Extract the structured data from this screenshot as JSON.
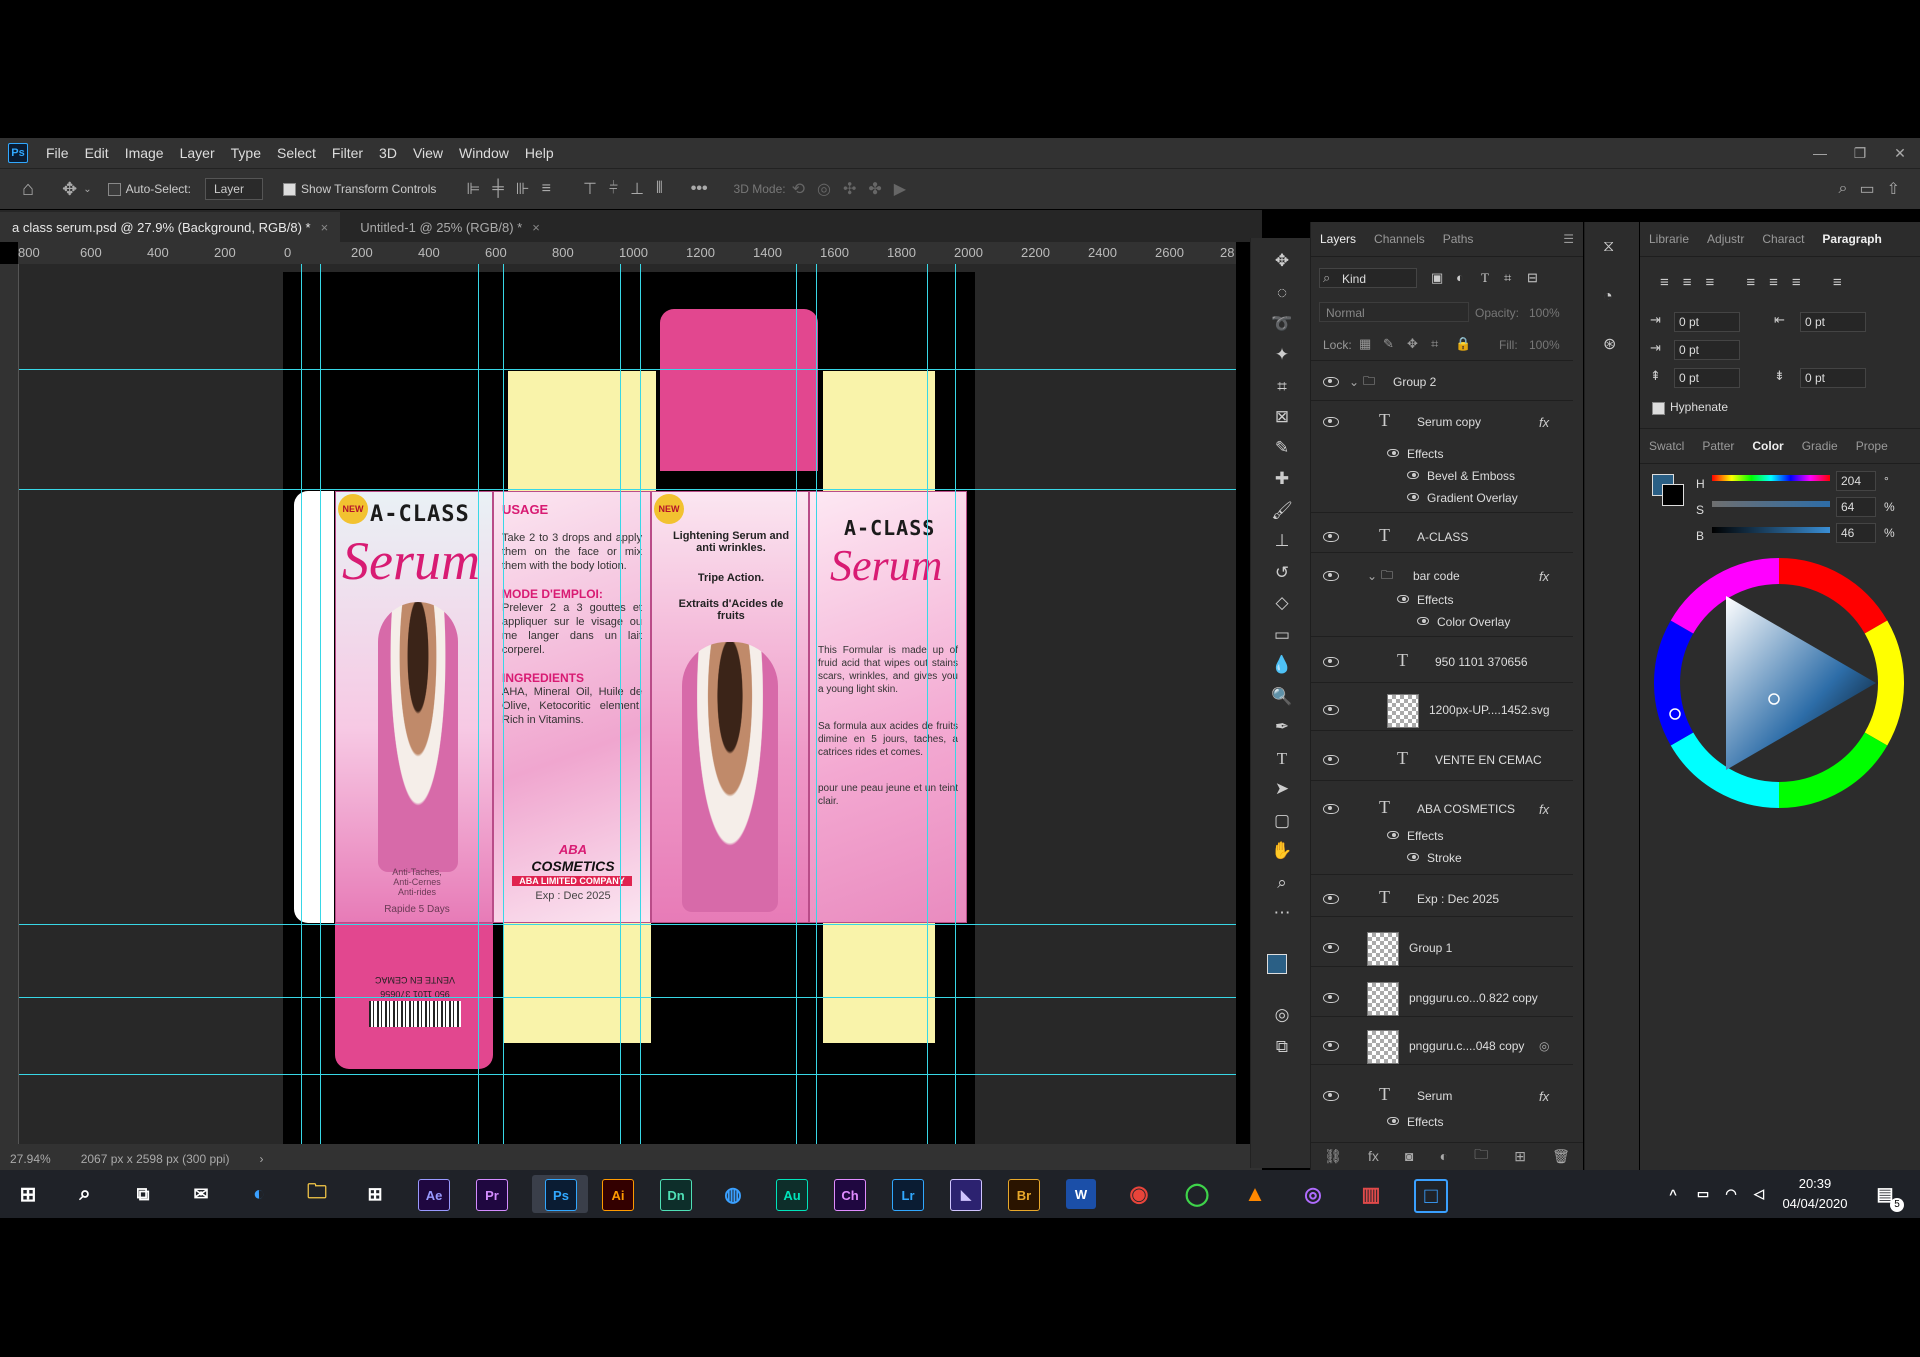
{
  "menu": [
    "File",
    "Edit",
    "Image",
    "Layer",
    "Type",
    "Select",
    "Filter",
    "3D",
    "View",
    "Window",
    "Help"
  ],
  "app_icon": "Ps",
  "options": {
    "auto_select_label": "Auto-Select:",
    "layer_select": "Layer",
    "show_transform": "Show Transform Controls",
    "mode_label": "3D Mode:"
  },
  "tabs": [
    {
      "label": "a class serum.psd @ 27.9% (Background, RGB/8) *"
    },
    {
      "label": "Untitled-1 @ 25% (RGB/8) *"
    }
  ],
  "ruler_ticks": [
    "800",
    "600",
    "400",
    "200",
    "0",
    "200",
    "400",
    "600",
    "800",
    "1000",
    "1200",
    "1400",
    "1600",
    "1800",
    "2000",
    "2200",
    "2400",
    "2600",
    "28"
  ],
  "status": {
    "zoom": "27.94%",
    "doc_info": "2067 px x 2598 px (300 ppi)"
  },
  "artwork": {
    "brand_title": "A-CLASS",
    "product": "Serum",
    "new_badge": "NEW",
    "usage_heading": "USAGE",
    "usage_text": "Take 2 to 3 drops and apply them on the face or mix them with the body lotion.",
    "mode_heading": "MODE D'EMPLOI:",
    "mode_text": "Prelever 2 a 3 gouttes et appliquer sur le visage ou me langer dans un lait corperel.",
    "ingredients_heading": "INGREDIENTS",
    "ingredients_text": "AHA, Mineral Oil, Huile de Olive, Ketocoritic element. Rich in Vitamins.",
    "aba": "ABA",
    "cosmetics": "COSMETICS",
    "company": "ABA LIMITED COMPANY",
    "exp": "Exp : Dec 2025",
    "lightening": "Lightening Serum and anti wrinkles.",
    "triple": "Tripe Action.",
    "extraits": "Extraits d'Acides de fruits",
    "formula_en": "This Formular is made up of fruid acid that wipes out stains scars, wrinkles, and gives you a young light skin.",
    "formula_fr": "Sa formula aux acides de fruits dimine en 5 jours, taches, a catrices rides et comes.",
    "peau": "pour une peau jeune et un teint clair.",
    "claims": "Anti-Taches,\nAnti-Cernes\nAnti-rides",
    "rapide": "Rapide 5 Days",
    "vente": "VENTE EN CEMAC",
    "barcode_num": "950 1101 370656"
  },
  "layers_panel": {
    "tabs": [
      "Layers",
      "Channels",
      "Paths"
    ],
    "kind": "Kind",
    "blend": "Normal",
    "opacity_label": "Opacity:",
    "opacity": "100%",
    "lock_label": "Lock:",
    "fill_label": "Fill:",
    "fill": "100%",
    "rows": [
      {
        "label": "Group 2"
      },
      {
        "label": "Serum copy"
      },
      {
        "label": "Effects"
      },
      {
        "label": "Bevel & Emboss"
      },
      {
        "label": "Gradient Overlay"
      },
      {
        "label": "A-CLASS"
      },
      {
        "label": "bar code"
      },
      {
        "label": "Effects"
      },
      {
        "label": "Color Overlay"
      },
      {
        "label": "950 1101  370656"
      },
      {
        "label": "1200px-UP....1452.svg"
      },
      {
        "label": "VENTE EN CEMAC"
      },
      {
        "label": "ABA COSMETICS"
      },
      {
        "label": "Effects"
      },
      {
        "label": "Stroke"
      },
      {
        "label": "Exp : Dec 2025"
      },
      {
        "label": "Group 1"
      },
      {
        "label": "pngguru.co...0.822 copy"
      },
      {
        "label": "pngguru.c....048 copy"
      },
      {
        "label": "Serum"
      },
      {
        "label": "Effects"
      }
    ]
  },
  "right_panel": {
    "top_tabs": [
      "Librarie",
      "Adjustr",
      "Charact",
      "Paragraph"
    ],
    "indent_values": [
      "0 pt",
      "0 pt",
      "0 pt",
      "0 pt",
      "0 pt",
      "0 pt"
    ],
    "hyphenate": "Hyphenate",
    "color_tabs": [
      "Swatcl",
      "Patter",
      "Color",
      "Gradie",
      "Prope"
    ],
    "h_label": "H",
    "s_label": "S",
    "b_label": "B",
    "h_val": "204",
    "s_val": "64",
    "b_val": "46",
    "deg": "°",
    "pct": "%",
    "fg_color": "#2a5f85"
  },
  "taskbar": {
    "apps": [
      "Ae",
      "Pr",
      "Ps",
      "Ai",
      "Dn",
      "Au",
      "Ch",
      "Lr",
      "Br",
      "W"
    ],
    "time": "20:39",
    "date": "04/04/2020",
    "notif": "5"
  }
}
